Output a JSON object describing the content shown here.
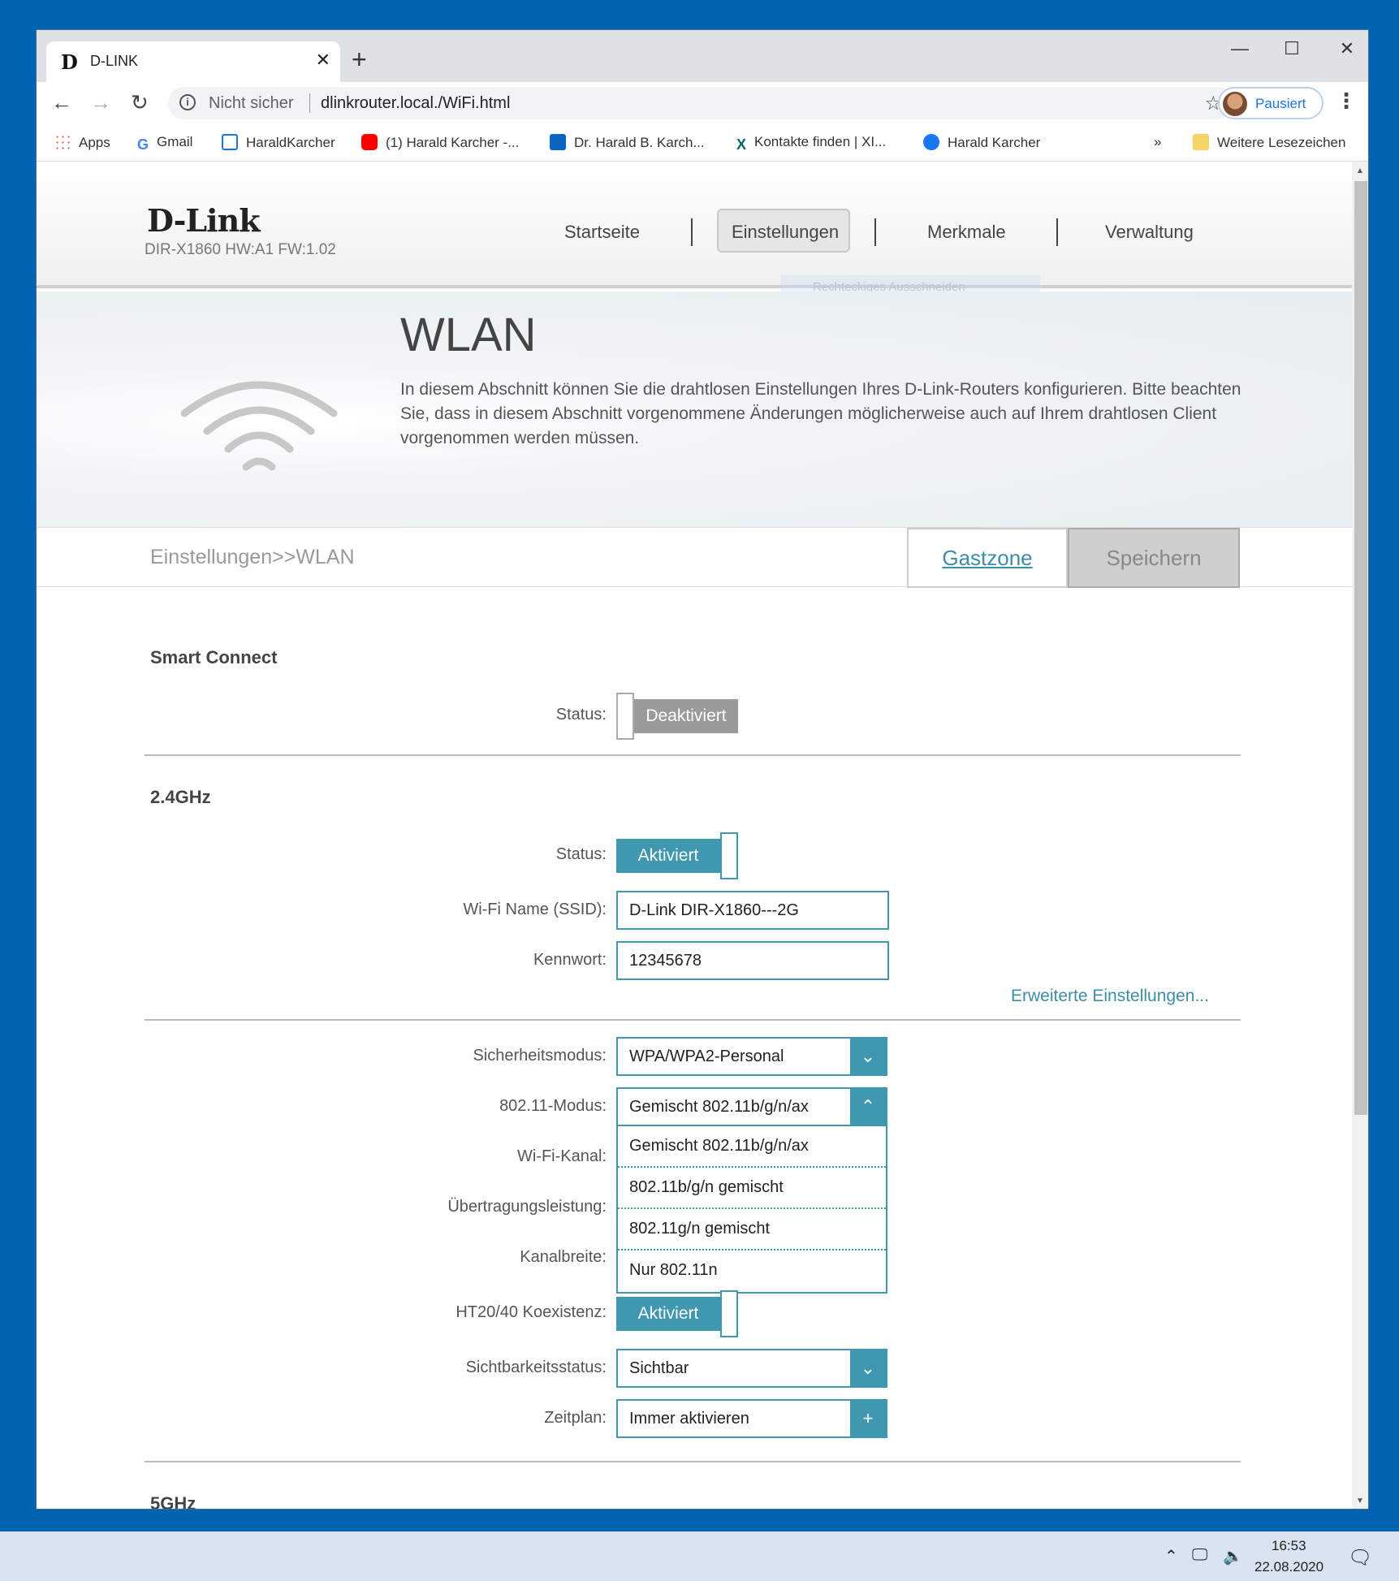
{
  "browser": {
    "tab_title": "D-LINK",
    "tab_favicon": "D",
    "address_warning": "Nicht sicher",
    "address_url": "dlinkrouter.local./WiFi.html",
    "profile_label": "Pausiert",
    "new_tab_symbol": "+",
    "close_symbol": "✕",
    "bookmarks": [
      {
        "label": "Apps",
        "icon": "apps-grid-icon",
        "color": "#ea4335"
      },
      {
        "label": "Gmail",
        "icon": "google-g-icon",
        "color": "#4285f4"
      },
      {
        "label": "HaraldKarcher",
        "icon": "calendar-icon",
        "color": "#1a73e8"
      },
      {
        "label": "(1) Harald Karcher -...",
        "icon": "youtube-icon",
        "color": "#ff0000"
      },
      {
        "label": "Dr. Harald B. Karch...",
        "icon": "linkedin-icon",
        "color": "#0a66c2"
      },
      {
        "label": "Kontakte finden | XI...",
        "icon": "xing-icon",
        "color": "#026466"
      },
      {
        "label": "Harald Karcher",
        "icon": "facebook-icon",
        "color": "#1877f2"
      }
    ],
    "bookmarks_more": "»",
    "other_bookmarks": "Weitere Lesezeichen"
  },
  "router": {
    "brand": "D-Link",
    "model_info": "DIR-X1860 HW:A1 FW:1.02",
    "nav": [
      "Startseite",
      "Einstellungen",
      "Merkmale",
      "Verwaltung"
    ],
    "nav_active": "Einstellungen",
    "ghost_overlay": "Rechteckiges Ausschneiden",
    "page_title": "WLAN",
    "page_description": "In diesem Abschnitt können Sie die drahtlosen Einstellungen Ihres D-Link-Routers konfigurieren. Bitte beachten Sie, dass in diesem Abschnitt vorgenommene Änderungen möglicherweise auch auf Ihrem drahtlosen Client vorgenommen werden müssen.",
    "breadcrumb": "Einstellungen>>WLAN",
    "guest_zone_label": "Gastzone",
    "save_label": "Speichern"
  },
  "smart_connect": {
    "title": "Smart Connect",
    "status_label": "Status:",
    "status_value": "Deaktiviert"
  },
  "band_24": {
    "title": "2.4GHz",
    "status_label": "Status:",
    "status_value": "Aktiviert",
    "ssid_label": "Wi-Fi Name (SSID):",
    "ssid_value": "D-Link DIR-X1860---2G",
    "password_label": "Kennwort:",
    "password_value": "12345678",
    "advanced_link": "Erweiterte Einstellungen...",
    "security_label": "Sicherheitsmodus:",
    "security_value": "WPA/WPA2-Personal",
    "mode_label": "802.11-Modus:",
    "mode_value": "Gemischt 802.11b/g/n/ax",
    "mode_options": [
      "Gemischt 802.11b/g/n/ax",
      "802.11b/g/n gemischt",
      "802.11g/n gemischt",
      "Nur 802.11n"
    ],
    "channel_label": "Wi-Fi-Kanal:",
    "power_label": "Übertragungsleistung:",
    "bandwidth_label": "Kanalbreite:",
    "coexist_label": "HT20/40 Koexistenz:",
    "coexist_value": "Aktiviert",
    "visibility_label": "Sichtbarkeitsstatus:",
    "visibility_value": "Sichtbar",
    "schedule_label": "Zeitplan:",
    "schedule_value": "Immer aktivieren"
  },
  "band_5": {
    "title": "5GHz"
  },
  "taskbar": {
    "time": "16:53",
    "date": "22.08.2020"
  }
}
